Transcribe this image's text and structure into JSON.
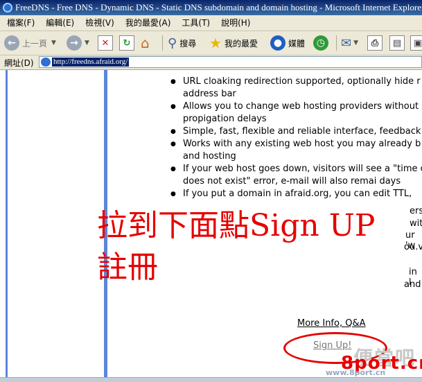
{
  "window": {
    "title": "FreeDNS - Free DNS - Dynamic DNS - Static DNS subdomain and domain hosting - Microsoft Internet Explorer"
  },
  "menu": [
    "檔案(F)",
    "編輯(E)",
    "檢視(V)",
    "我的最愛(A)",
    "工具(T)",
    "說明(H)"
  ],
  "toolbar": {
    "back_label": "上一頁",
    "search_label": "搜尋",
    "favorites_label": "我的最愛",
    "media_label": "媒體"
  },
  "address": {
    "label": "網址(D)",
    "url": "http://freedns.afraid.org/"
  },
  "features": [
    "URL cloaking redirection supported, optionally hide r in the address bar",
    "Allows you to change web hosting providers without propigation delays",
    "Simple, fast, flexible and reliable interface, feedback",
    "Works with any existing web host you may already b DNS and hosting",
    "If your web host goes down, visitors will see a \"time of a \"site does not exist\" error, e-mail will also remai days",
    "If you put a domain in afraid.org, you can edit TTL,"
  ],
  "fragments": [
    "ers",
    "wit",
    "ur 'w",
    "ou.v",
    "in l",
    "and"
  ],
  "annotation": {
    "line1": "拉到下面點Sign UP",
    "line2": "註冊"
  },
  "links": {
    "more_info": "More Info, Q&A",
    "sign_up": "Sign Up!"
  },
  "watermark": {
    "line1": "便當吧",
    "line2": "8port.cn",
    "line3": "www.8port.cn"
  },
  "colors": {
    "annotation_red": "#e60000",
    "frame_blue": "#5b86d9"
  }
}
